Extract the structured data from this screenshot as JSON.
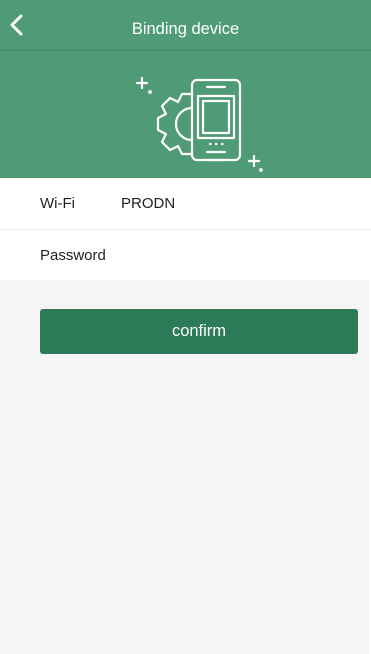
{
  "colors": {
    "brand_green": "#4e9b76",
    "button_green": "#2c7a58"
  },
  "nav": {
    "back_icon": "chevron-left-icon",
    "title": "Binding device"
  },
  "header": {
    "illustration_icon": "device-settings-gear-icon"
  },
  "form": {
    "wifi": {
      "label": "Wi-Fi",
      "value": "PRODN"
    },
    "password": {
      "label": "Password",
      "value": "",
      "placeholder": ""
    }
  },
  "confirm_label": "confirm"
}
